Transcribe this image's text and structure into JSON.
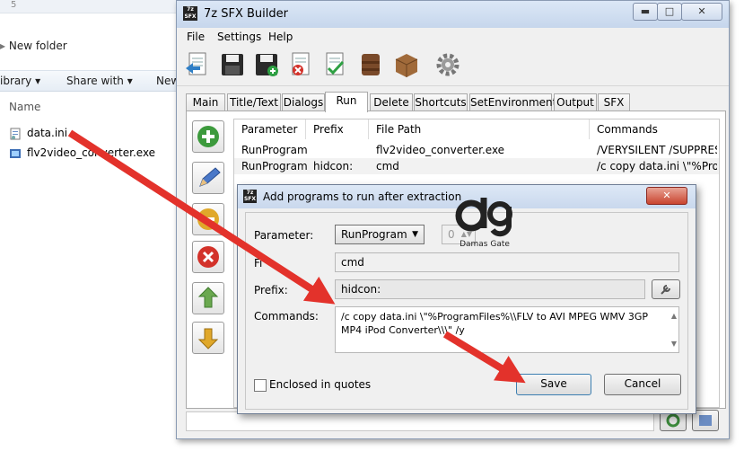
{
  "explorer": {
    "top_number": "5",
    "path": "New folder",
    "toolbar": {
      "library": "ibrary ▾",
      "share": "Share with ▾",
      "new": "New"
    },
    "column": "Name",
    "files": [
      "data.ini",
      "flv2video_converter.exe"
    ]
  },
  "window": {
    "title": "7z SFX Builder",
    "icon_text": "7z SFX",
    "menu": [
      "File",
      "Settings",
      "Help"
    ],
    "tabs": [
      "Main",
      "Title/Text",
      "Dialogs",
      "Run",
      "Delete",
      "Shortcuts",
      "SetEnvironment",
      "Output",
      "SFX"
    ],
    "active_tab": "Run",
    "grid": {
      "headers": [
        "Parameter",
        "Prefix",
        "File Path",
        "Commands"
      ],
      "rows": [
        [
          "RunProgram",
          "",
          "flv2video_converter.exe",
          "/VERYSILENT /SUPPRESS..."
        ],
        [
          "RunProgram",
          "hidcon:",
          "cmd",
          "/c copy data.ini \\\"%Progr..."
        ]
      ]
    }
  },
  "dialog": {
    "title": "Add programs to run after extraction",
    "parameter_label": "Parameter:",
    "parameter_value": "RunProgram",
    "spin_value": "0",
    "file_label": "Fi",
    "file_value": "cmd",
    "prefix_label": "Prefix:",
    "prefix_value": "hidcon:",
    "commands_label": "Commands:",
    "commands_value": "/c copy data.ini \\\"%ProgramFiles%\\\\FLV to AVI MPEG WMV 3GP MP4 iPod Converter\\\\\\\" /y",
    "checkbox_label": "Enclosed in quotes",
    "save": "Save",
    "cancel": "Cancel"
  },
  "watermark": {
    "text": "Damas Gate"
  },
  "colors": {
    "arrow": "#e3322b",
    "accent": "#c6d6ec"
  }
}
